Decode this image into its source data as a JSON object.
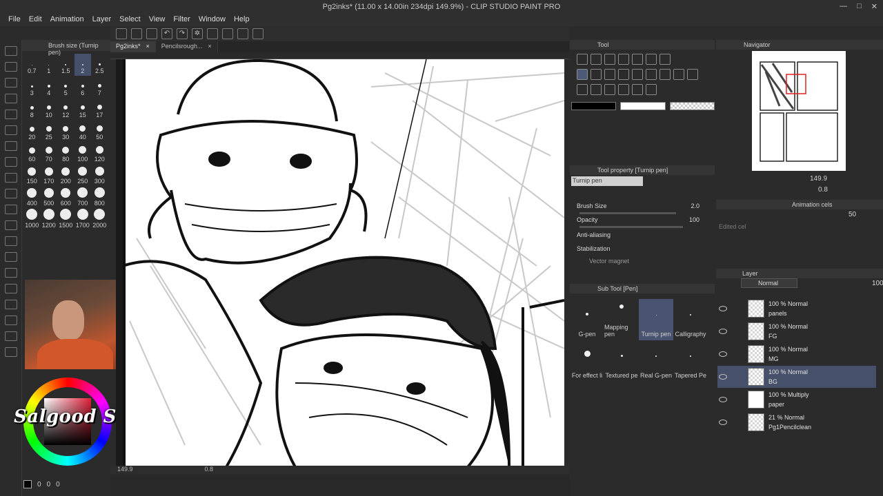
{
  "window": {
    "title": "Pg2inks* (11.00 x 14.00in 234dpi 149.9%) - CLIP STUDIO PAINT PRO",
    "controls": [
      "—",
      "□",
      "✕"
    ]
  },
  "menu": [
    "File",
    "Edit",
    "Animation",
    "Layer",
    "Select",
    "View",
    "Filter",
    "Window",
    "Help"
  ],
  "brush_size_panel": {
    "title": "Brush size (Turnip pen)",
    "sizes": [
      "0.7",
      "1",
      "1.5",
      "2",
      "2.5",
      "3",
      "4",
      "5",
      "6",
      "7",
      "8",
      "10",
      "12",
      "15",
      "17",
      "20",
      "25",
      "30",
      "40",
      "50",
      "60",
      "70",
      "80",
      "100",
      "120",
      "150",
      "170",
      "200",
      "250",
      "300",
      "400",
      "500",
      "600",
      "700",
      "800",
      "1000",
      "1200",
      "1500",
      "1700",
      "2000"
    ],
    "selected": "2"
  },
  "streamer_name": "Salgood Sam",
  "color_values": [
    "0",
    "0",
    "0"
  ],
  "canvas": {
    "tabs": [
      {
        "label": "Pg2inks*",
        "close": "×"
      },
      {
        "label": "Pencilsrough...",
        "close": "×"
      }
    ],
    "zoom": "149.9",
    "rotation": "0.8"
  },
  "tool_panel": {
    "title": "Tool"
  },
  "tool_property": {
    "title": "Tool property [Turnip pen]",
    "brush_name": "Turnip pen",
    "rows": [
      {
        "label": "Brush Size",
        "value": "2.0"
      },
      {
        "label": "Opacity",
        "value": "100"
      },
      {
        "label": "Anti-aliasing",
        "value": ""
      },
      {
        "label": "Stabilization",
        "value": ""
      },
      {
        "label": "Vector magnet",
        "value": ""
      }
    ]
  },
  "sub_tool": {
    "title": "Sub Tool [Pen]",
    "items": [
      "G-pen",
      "Mapping pen",
      "Turnip pen",
      "Calligraphy",
      "For effect li",
      "Textured pe",
      "Real G-pen",
      "Tapered Pe"
    ],
    "selected": "Turnip pen"
  },
  "navigator": {
    "title": "Navigator",
    "zoom": "149.9",
    "rotation": "0.8"
  },
  "animation_cels": {
    "title": "Animation cels",
    "opacity": "50",
    "edited_cel": "Edited cel"
  },
  "layer_panel": {
    "title": "Layer",
    "blend_mode": "Normal",
    "opacity": "100",
    "layers": [
      {
        "mode": "100 % Normal",
        "name": "panels",
        "thumb": "checker"
      },
      {
        "mode": "100 % Normal",
        "name": "FG",
        "thumb": "checker"
      },
      {
        "mode": "100 % Normal",
        "name": "MG",
        "thumb": "checker"
      },
      {
        "mode": "100 % Normal",
        "name": "BG",
        "thumb": "checker",
        "selected": true
      },
      {
        "mode": "100 % Multiply",
        "name": "paper",
        "thumb": "solid"
      },
      {
        "mode": "21 % Normal",
        "name": "Pg1Pencilclean",
        "thumb": "checker"
      }
    ]
  },
  "colors": {
    "background": "#2b2b2b",
    "selection": "#46506a",
    "accent": "#4c5a77"
  }
}
